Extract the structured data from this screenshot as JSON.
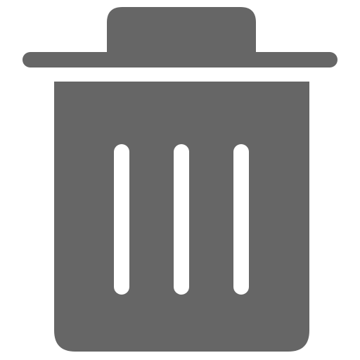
{
  "icon": {
    "name": "trash-icon",
    "color": "#666666",
    "background": "#ffffff"
  }
}
